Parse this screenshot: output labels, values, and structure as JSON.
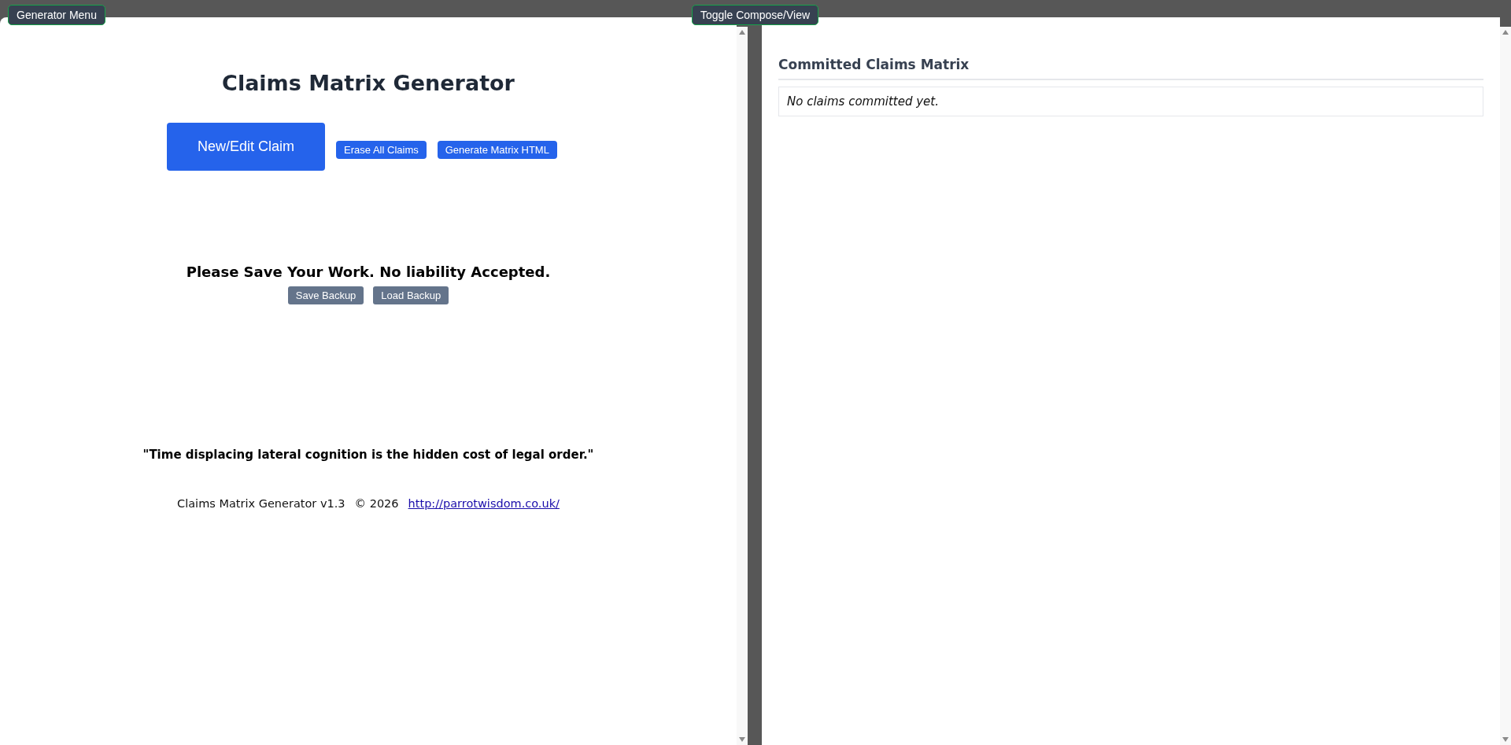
{
  "top_bar": {
    "menu_button": "Generator Menu",
    "toggle_button": "Toggle Compose/View"
  },
  "compose": {
    "title": "Claims Matrix Generator",
    "actions": [
      {
        "label": "New/Edit Claim",
        "kind": "primary"
      },
      {
        "label": "Erase All Claims",
        "kind": "small"
      },
      {
        "label": "Generate Matrix HTML",
        "kind": "small"
      }
    ],
    "warning": "Please Save Your Work. No liability Accepted.",
    "backup_buttons": [
      "Save Backup",
      "Load Backup"
    ],
    "quote": "\"Time displacing lateral cognition is the hidden cost of legal order.\"",
    "footer": {
      "version": "Claims Matrix Generator v1.3",
      "copyright": "© 2026",
      "link": "http://parrotwisdom.co.uk/"
    }
  },
  "view": {
    "heading": "Committed Claims Matrix",
    "empty_message": "No claims committed yet."
  }
}
